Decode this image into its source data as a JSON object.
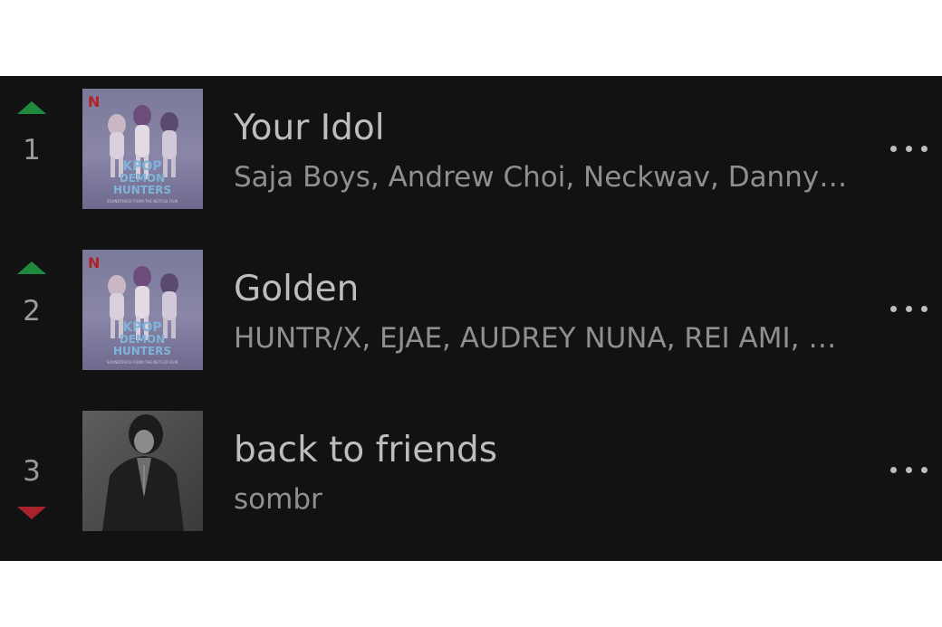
{
  "chart": {
    "tracks": [
      {
        "rank": "1",
        "trend": "up",
        "title": "Your Idol",
        "artists": "Saja Boys, Andrew Choi, Neckwav, Danny Chung, KEVIN WOO, samUIL Lee",
        "cover": {
          "logo": "N",
          "line1": "KPOP",
          "line2": "DEMON",
          "line3": "HUNTERS",
          "tagline": "SOUNDTRACK FROM THE NETFLIX FILM"
        }
      },
      {
        "rank": "2",
        "trend": "up",
        "title": "Golden",
        "artists": "HUNTR/X, EJAE, AUDREY NUNA, REI AMI, KPop Demon Hunters Cast",
        "cover": {
          "logo": "N",
          "line1": "KPOP",
          "line2": "DEMON",
          "line3": "HUNTERS",
          "tagline": "SOUNDTRACK FROM THE NETFLIX FILM"
        }
      },
      {
        "rank": "3",
        "trend": "down",
        "title": "back to friends",
        "artists": "sombr"
      }
    ]
  },
  "colors": {
    "background": "#121212",
    "trend_up": "#1f8a3e",
    "trend_down": "#a8232e",
    "title_text": "#bdbdbd",
    "artist_text": "#8f8f8f"
  },
  "icons": {
    "trend_up": "triangle-up-icon",
    "trend_down": "triangle-down-icon",
    "more": "more-horizontal-icon"
  }
}
